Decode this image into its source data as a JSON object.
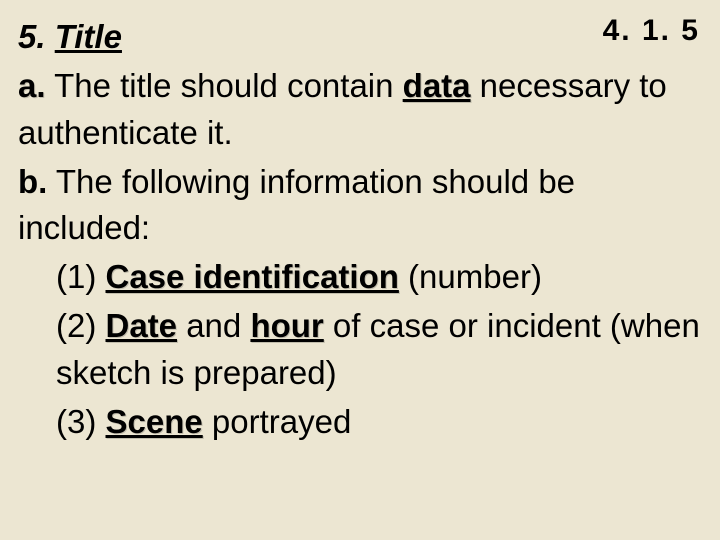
{
  "corner_ref": "4. 1. 5",
  "heading_num": "5. ",
  "heading_word": "Title",
  "a_label": "a.",
  "a_pre": " The title should contain ",
  "a_key": "data",
  "a_post": " necessary to authenticate it.",
  "b_label": "b.",
  "b_text": " The following information should be included:",
  "i1_num": "(1) ",
  "i1_key": "Case identification",
  "i1_post": " (number)",
  "i2_num": "(2) ",
  "i2_k1": "Date",
  "i2_mid1": " and ",
  "i2_k2": "hour",
  "i2_post": " of case or incident (when sketch is prepared)",
  "i3_num": "(3) ",
  "i3_key": "Scene",
  "i3_post": " portrayed"
}
